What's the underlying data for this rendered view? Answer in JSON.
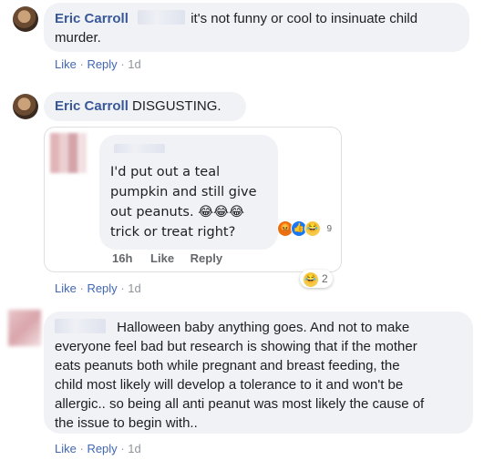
{
  "comments": [
    {
      "author": "Eric Carroll",
      "text_line1": "it's not funny or cool to insinuate child",
      "text_line2": "murder.",
      "actions": {
        "like": "Like",
        "reply": "Reply",
        "time": "1d"
      }
    },
    {
      "author": "Eric Carroll",
      "text": "DISGUSTING.",
      "shared_image": {
        "lines": [
          "I'd put out a teal",
          "pumpkin and still give",
          "out peanuts. 😂😂😂",
          "trick or treat right?"
        ],
        "time": "16h",
        "like": "Like",
        "reply": "Reply",
        "reaction_count": "9"
      },
      "reaction_pill": {
        "emoji": "😂",
        "count": "2"
      },
      "actions": {
        "like": "Like",
        "reply": "Reply",
        "time": "1d"
      }
    },
    {
      "text_lines": [
        "Halloween baby anything goes. And not to make",
        "everyone feel bad but research is showing that if the mother",
        "eats peanuts both while pregnant and breast feeding, the",
        "child most likely will develop a tolerance to it and won't be",
        "allergic.. so being all anti peanut was most likely the cause of",
        "the issue to begin with.."
      ],
      "actions": {
        "like": "Like",
        "reply": "Reply",
        "time": "1d"
      }
    }
  ]
}
